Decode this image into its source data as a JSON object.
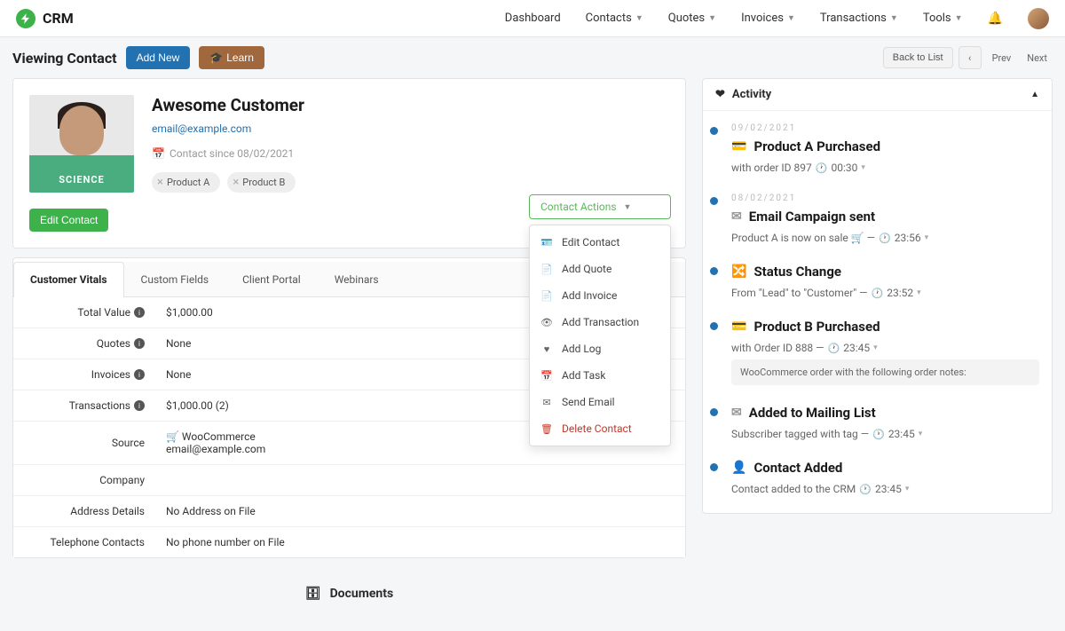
{
  "brand": "CRM",
  "topnav": {
    "dashboard": "Dashboard",
    "contacts": "Contacts",
    "quotes": "Quotes",
    "invoices": "Invoices",
    "transactions": "Transactions",
    "tools": "Tools"
  },
  "subheader": {
    "title": "Viewing Contact",
    "add_new": "Add New",
    "learn": "Learn",
    "back_to_list": "Back to List",
    "prev": "Prev",
    "next": "Next"
  },
  "contact": {
    "name": "Awesome Customer",
    "email": "email@example.com",
    "since_label": "Contact since 08/02/2021",
    "tags": {
      "a": "Product A",
      "b": "Product B"
    },
    "edit_button": "Edit Contact",
    "shirt_text": "SCIENCE"
  },
  "actions": {
    "button": "Contact Actions",
    "edit": "Edit Contact",
    "add_quote": "Add Quote",
    "add_invoice": "Add Invoice",
    "add_transaction": "Add Transaction",
    "add_log": "Add Log",
    "add_task": "Add Task",
    "send_email": "Send Email",
    "delete": "Delete Contact"
  },
  "tabs": {
    "vitals": "Customer Vitals",
    "custom": "Custom Fields",
    "portal": "Client Portal",
    "webinars": "Webinars"
  },
  "vitals": {
    "total_value_label": "Total Value",
    "total_value": "$1,000.00",
    "quotes_label": "Quotes",
    "quotes": "None",
    "invoices_label": "Invoices",
    "invoices": "None",
    "transactions_label": "Transactions",
    "transactions": "$1,000.00 (2)",
    "source_label": "Source",
    "source_line1": "🛒 WooCommerce",
    "source_line2": "email@example.com",
    "company_label": "Company",
    "company": "",
    "address_label": "Address Details",
    "address": "No Address on File",
    "phone_label": "Telephone Contacts",
    "phone": "No phone number on File"
  },
  "documents_label": "Documents",
  "activity": {
    "heading": "Activity",
    "items": [
      {
        "date": "09/02/2021",
        "title": "Product A Purchased",
        "desc_pre": "with order ID 897",
        "time": "00:30",
        "icon": "card"
      },
      {
        "date": "08/02/2021",
        "title": "Email Campaign sent",
        "desc_pre": "Product A is now on sale 🛒 —",
        "time": "23:56",
        "icon": "mail"
      },
      {
        "date": "",
        "title": "Status Change",
        "desc_pre": "From \"Lead\" to \"Customer\" —",
        "time": "23:52",
        "icon": "shuffle"
      },
      {
        "date": "",
        "title": "Product B Purchased",
        "desc_pre": "with Order ID 888 —",
        "time": "23:45",
        "note": "WooCommerce order with the following order notes:",
        "icon": "card"
      },
      {
        "date": "",
        "title": "Added to Mailing List",
        "desc_pre": "Subscriber tagged with tag —",
        "time": "23:45",
        "icon": "mail"
      },
      {
        "date": "",
        "title": "Contact Added",
        "desc_pre": "Contact added to the CRM",
        "time": "23:45",
        "icon": "user"
      }
    ]
  }
}
